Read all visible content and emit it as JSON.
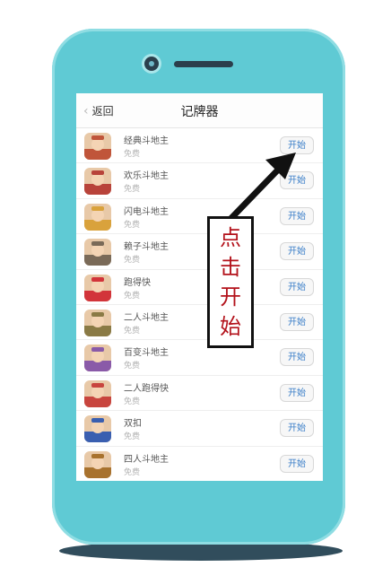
{
  "header": {
    "back_label": "返回",
    "title": "记牌器"
  },
  "apps": [
    {
      "name": "经典斗地主",
      "price": "免费",
      "button": "开始",
      "icon_color": "#c0553a"
    },
    {
      "name": "欢乐斗地主",
      "price": "免费",
      "button": "开始",
      "icon_color": "#b8433a"
    },
    {
      "name": "闪电斗地主",
      "price": "免费",
      "button": "开始",
      "icon_color": "#d9a23c"
    },
    {
      "name": "赖子斗地主",
      "price": "免费",
      "button": "开始",
      "icon_color": "#7a6a58"
    },
    {
      "name": "跑得快",
      "price": "免费",
      "button": "开始",
      "icon_color": "#d2343a"
    },
    {
      "name": "二人斗地主",
      "price": "免费",
      "button": "开始",
      "icon_color": "#8a7a45"
    },
    {
      "name": "百变斗地主",
      "price": "免费",
      "button": "开始",
      "icon_color": "#8a5aa8"
    },
    {
      "name": "二人跑得快",
      "price": "免费",
      "button": "开始",
      "icon_color": "#c8453e"
    },
    {
      "name": "双扣",
      "price": "免费",
      "button": "开始",
      "icon_color": "#3a5fb0"
    },
    {
      "name": "四人斗地主",
      "price": "免费",
      "button": "开始",
      "icon_color": "#a8722e"
    }
  ],
  "annotation": {
    "chars": [
      "点",
      "击",
      "开",
      "始"
    ]
  },
  "colors": {
    "phone_body": "#5fcad4",
    "button_text": "#3a7ec8",
    "annotation_text": "#b3121b"
  }
}
